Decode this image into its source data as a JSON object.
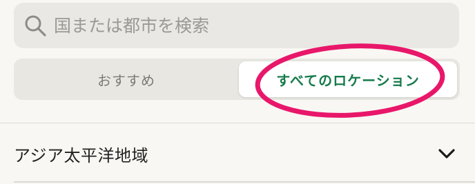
{
  "search": {
    "placeholder": "国または都市を検索",
    "value": ""
  },
  "tabs": [
    {
      "label": "おすすめ",
      "active": false
    },
    {
      "label": "すべてのロケーション",
      "active": true
    }
  ],
  "regions": [
    {
      "label": "アジア太平洋地域",
      "expanded": false
    }
  ],
  "icons": {
    "search": "search-icon",
    "chevron": "chevron-down-icon"
  },
  "colors": {
    "accent": "#157a4a",
    "highlight_annotation": "#e8176a",
    "background": "#f8f7f3"
  }
}
